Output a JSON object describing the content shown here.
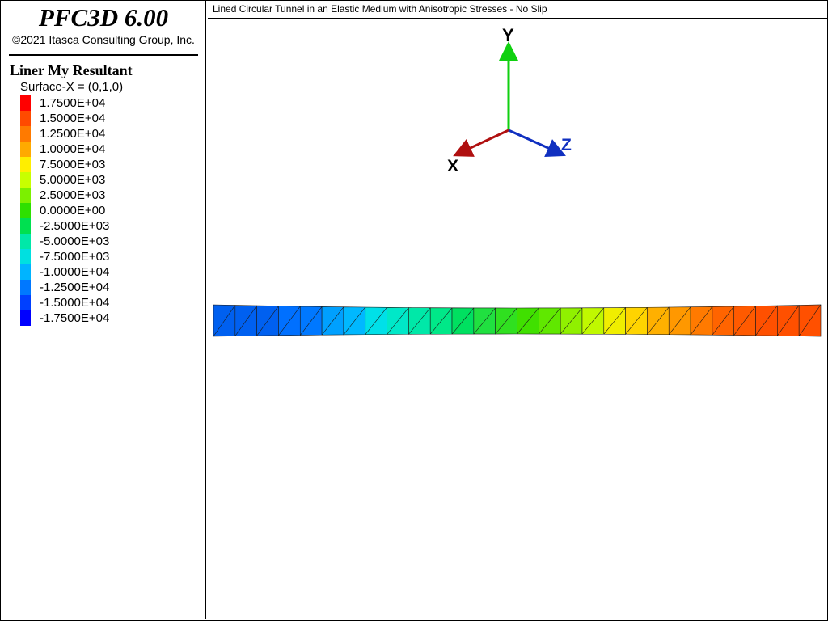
{
  "app": {
    "title": "PFC3D 6.00",
    "copyright": "©2021 Itasca Consulting Group, Inc."
  },
  "legend": {
    "title": "Liner My Resultant",
    "subtitle": "Surface-X = (0,1,0)",
    "items": [
      {
        "label": "1.7500E+04",
        "color": "#ff0000"
      },
      {
        "label": "1.5000E+04",
        "color": "#ff4a00"
      },
      {
        "label": "1.2500E+04",
        "color": "#ff7a00"
      },
      {
        "label": "1.0000E+04",
        "color": "#ffaa00"
      },
      {
        "label": "7.5000E+03",
        "color": "#ffee00"
      },
      {
        "label": "5.0000E+03",
        "color": "#c8ff00"
      },
      {
        "label": "2.5000E+03",
        "color": "#7cf000"
      },
      {
        "label": "0.0000E+00",
        "color": "#2ee000"
      },
      {
        "label": "-2.5000E+03",
        "color": "#00e050"
      },
      {
        "label": "-5.0000E+03",
        "color": "#00e8a8"
      },
      {
        "label": "-7.5000E+03",
        "color": "#00e0e0"
      },
      {
        "label": "-1.0000E+04",
        "color": "#00b4ff"
      },
      {
        "label": "-1.2500E+04",
        "color": "#0078ff"
      },
      {
        "label": "-1.5000E+04",
        "color": "#0040ff"
      },
      {
        "label": "-1.7500E+04",
        "color": "#0000ff"
      }
    ]
  },
  "view": {
    "title": "Lined Circular Tunnel in an Elastic Medium with Anisotropic Stresses - No Slip",
    "axes": {
      "x_label": "X",
      "y_label": "Y",
      "z_label": "Z",
      "x_color": "#b01010",
      "y_color": "#10d010",
      "z_color": "#1030c0"
    }
  },
  "liner_band": {
    "segments": [
      "#0060f0",
      "#0060f0",
      "#0060f0",
      "#0070ff",
      "#0078ff",
      "#00a0ff",
      "#00b8ff",
      "#00e0e8",
      "#00e8c8",
      "#00e8a8",
      "#00e888",
      "#00e060",
      "#20e040",
      "#30e020",
      "#40e000",
      "#60e800",
      "#90f000",
      "#c0f800",
      "#f0ee00",
      "#ffd400",
      "#ffb000",
      "#ff9800",
      "#ff7a00",
      "#ff6400",
      "#ff5a00",
      "#ff5000",
      "#ff5000",
      "#ff5000"
    ]
  }
}
